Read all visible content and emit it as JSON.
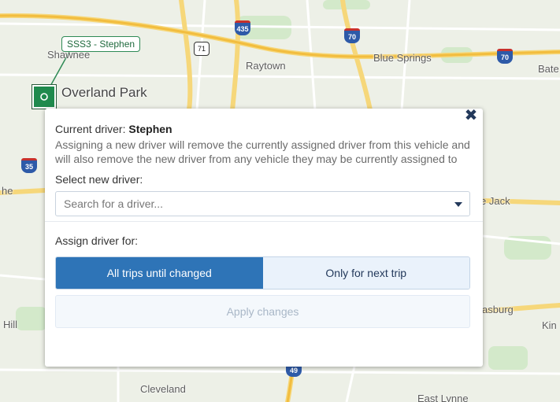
{
  "map": {
    "labels": {
      "shawnee": "Shawnee",
      "overland_park": "Overland Park",
      "raytown": "Raytown",
      "blue_springs": "Blue Springs",
      "bate": "Bate",
      "the": "he",
      "lone_jack": "e Jack",
      "hill": "Hill",
      "harrisonburg": "asburg",
      "kin": "Kin",
      "cleveland": "Cleveland",
      "east_lynne": "East Lynne"
    },
    "shields": {
      "i435": "435",
      "i70_a": "70",
      "i70_b": "70",
      "i35": "35",
      "i49": "49",
      "us71": "71"
    },
    "vehicle_tag": "SSS3 - Stephen",
    "vehicle_marker_icon": "pin-icon"
  },
  "popup": {
    "close_icon": "close-icon",
    "current_driver_prefix": "Current driver:",
    "current_driver_name": "Stephen",
    "warning_text": "Assigning a new driver will remove the currently assigned driver from this vehicle and will also remove the new driver from any vehicle they may be currently assigned to",
    "select_label": "Select new driver:",
    "search_placeholder": "Search for a driver...",
    "search_value": "",
    "assign_label": "Assign driver for:",
    "options": [
      {
        "label": "All trips until changed",
        "active": true
      },
      {
        "label": "Only for next trip",
        "active": false
      }
    ],
    "apply_label": "Apply changes",
    "colors": {
      "accent": "#2e74b7",
      "dark_navy": "#23395b",
      "marker_green": "#1f8a4d"
    }
  }
}
